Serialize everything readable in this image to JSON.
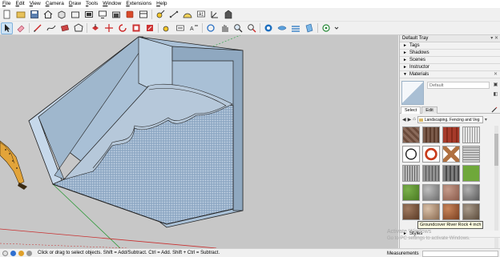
{
  "menu": [
    "File",
    "Edit",
    "View",
    "Camera",
    "Draw",
    "Tools",
    "Window",
    "Extensions",
    "Help"
  ],
  "toolbar_top": [
    "new-file-icon",
    "open-folder-icon",
    "save-icon",
    "home-icon",
    "box-icon",
    "folder-up-icon",
    "camera-icon",
    "monitor-icon",
    "warehouse-icon",
    "extension-icon",
    "layout-icon",
    "pan-icon",
    "tape-measure-icon",
    "protractor-icon",
    "axes-icon",
    "text-icon",
    "dimension-icon",
    "section-icon"
  ],
  "toolbar_main": [
    "select-icon",
    "eraser-icon",
    "paint-bucket-icon",
    "pencil-line-icon",
    "freehand-icon",
    "rectangle-icon",
    "polygon-icon",
    "push-pull-icon",
    "move-icon",
    "rotate-icon",
    "offset-icon",
    "scale-icon",
    "follow-me-icon",
    "tape-measure-icon",
    "dimension-icon",
    "text-icon",
    "orbit-icon",
    "pan-icon",
    "zoom-icon",
    "zoom-extents-icon",
    "walk-icon",
    "look-around-icon",
    "position-camera-icon",
    "section-plane-icon",
    "display-section-icon",
    "settings-icon"
  ],
  "tray": {
    "title": "Default Tray",
    "controls": "▾ ✕",
    "sections": [
      "Tags",
      "Shadows",
      "Scenes",
      "Instructor",
      "Materials"
    ],
    "material_name": "Default",
    "tabs": [
      "Select",
      "Edit"
    ],
    "library": "Landscaping, Fencing and Veg",
    "tooltip": "Groundcover River Rock 4 inch",
    "bottom_section": "Styles"
  },
  "swatches": [
    "#8a6a5a",
    "#7a5a4a",
    "#a63a2a",
    "#d8d8d8",
    "#e8e8e8",
    "#c83a1a",
    "#b07040",
    "#cfcfcf",
    "#b9b9b9",
    "#909090",
    "#7d7d7d",
    "#6fa83a",
    "#5c8f2e",
    "#9a9a9a",
    "#a87a6a",
    "#8a8a8a",
    "#7a5a45",
    "#b89a80",
    "#a3653f",
    "#8a7a6a"
  ],
  "watermark": {
    "title": "Activate Windows",
    "subtitle": "Go to PC settings to activate Windows."
  },
  "status": {
    "text": "Click or drag to select objects. Shift = Add/Subtract. Ctrl = Add. Shift + Ctrl = Subtract.",
    "measurements_label": "Measurements"
  }
}
